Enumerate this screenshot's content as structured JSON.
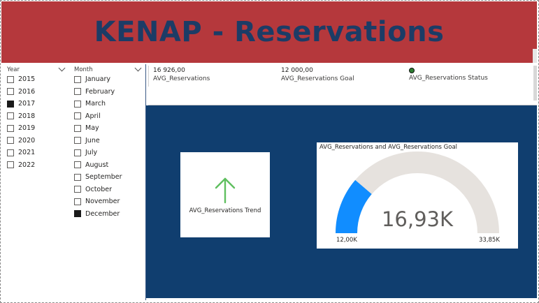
{
  "banner": {
    "title": "KENAP - Reservations",
    "bg_color": "#b5383c",
    "title_color": "#1c3c66"
  },
  "year_slicer": {
    "header": "Year",
    "items": [
      {
        "label": "2015",
        "checked": false
      },
      {
        "label": "2016",
        "checked": false
      },
      {
        "label": "2017",
        "checked": true
      },
      {
        "label": "2018",
        "checked": false
      },
      {
        "label": "2019",
        "checked": false
      },
      {
        "label": "2020",
        "checked": false
      },
      {
        "label": "2021",
        "checked": false
      },
      {
        "label": "2022",
        "checked": false
      }
    ]
  },
  "month_slicer": {
    "header": "Month",
    "items": [
      {
        "label": "January",
        "checked": false
      },
      {
        "label": "February",
        "checked": false
      },
      {
        "label": "March",
        "checked": false
      },
      {
        "label": "April",
        "checked": false
      },
      {
        "label": "May",
        "checked": false
      },
      {
        "label": "June",
        "checked": false
      },
      {
        "label": "July",
        "checked": false
      },
      {
        "label": "August",
        "checked": false
      },
      {
        "label": "September",
        "checked": false
      },
      {
        "label": "October",
        "checked": false
      },
      {
        "label": "November",
        "checked": false
      },
      {
        "label": "December",
        "checked": true
      }
    ]
  },
  "kpis": {
    "avg": {
      "value": "16 926,00",
      "label": "AVG_Reservations"
    },
    "goal": {
      "value": "12 000,00",
      "label": "AVG_Reservations Goal"
    },
    "status": {
      "label": "AVG_Reservations Status",
      "color": "#2e7d32"
    }
  },
  "canvas_color": "#103e6f",
  "trend": {
    "label": "AVG_Reservations Trend",
    "icon": "arrow-up-icon",
    "color": "#5fbf5f"
  },
  "gauge": {
    "title": "AVG_Reservations and AVG_Reservations Goal",
    "value_label": "16,93K",
    "min_label": "12,00K",
    "max_label": "33,85K",
    "value": 16926,
    "min": 12000,
    "max": 33852,
    "fill_color": "#118dff",
    "track_color": "#e6e2de"
  }
}
